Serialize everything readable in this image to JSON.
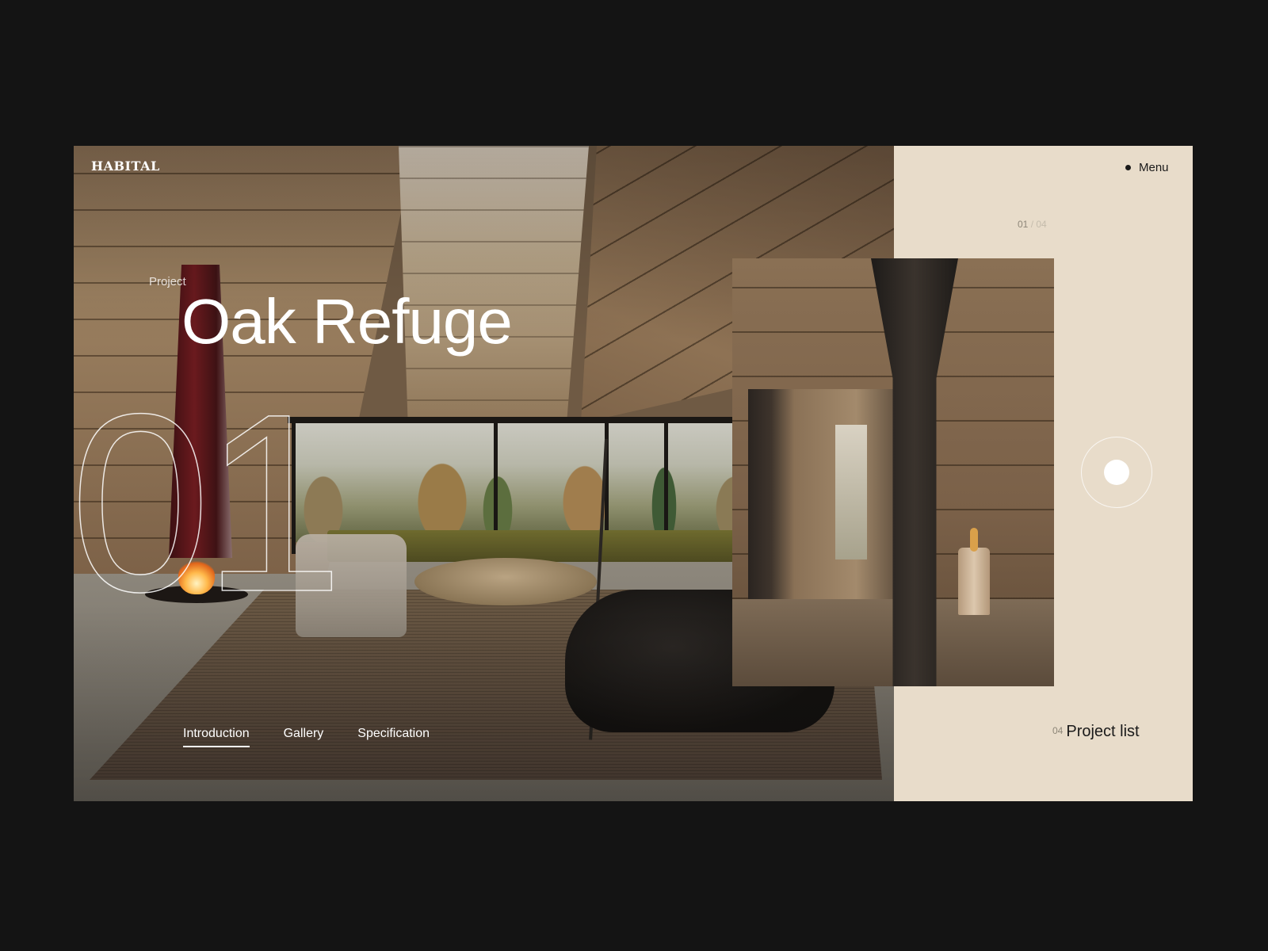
{
  "header": {
    "logo": "HABITAL",
    "menu_label": "Menu"
  },
  "slider": {
    "current": "01",
    "separator": " / ",
    "total": "04"
  },
  "hero": {
    "eyebrow": "Project",
    "title": "Oak Refuge",
    "big_number": "01"
  },
  "tabs": [
    {
      "label": "Introduction",
      "active": true
    },
    {
      "label": "Gallery",
      "active": false
    },
    {
      "label": "Specification",
      "active": false
    }
  ],
  "project_list": {
    "count": "04",
    "label": "Project list"
  },
  "colors": {
    "background": "#141414",
    "panel": "#e8dcca",
    "text_light": "#ffffff",
    "text_dark": "#1a1a1a"
  }
}
